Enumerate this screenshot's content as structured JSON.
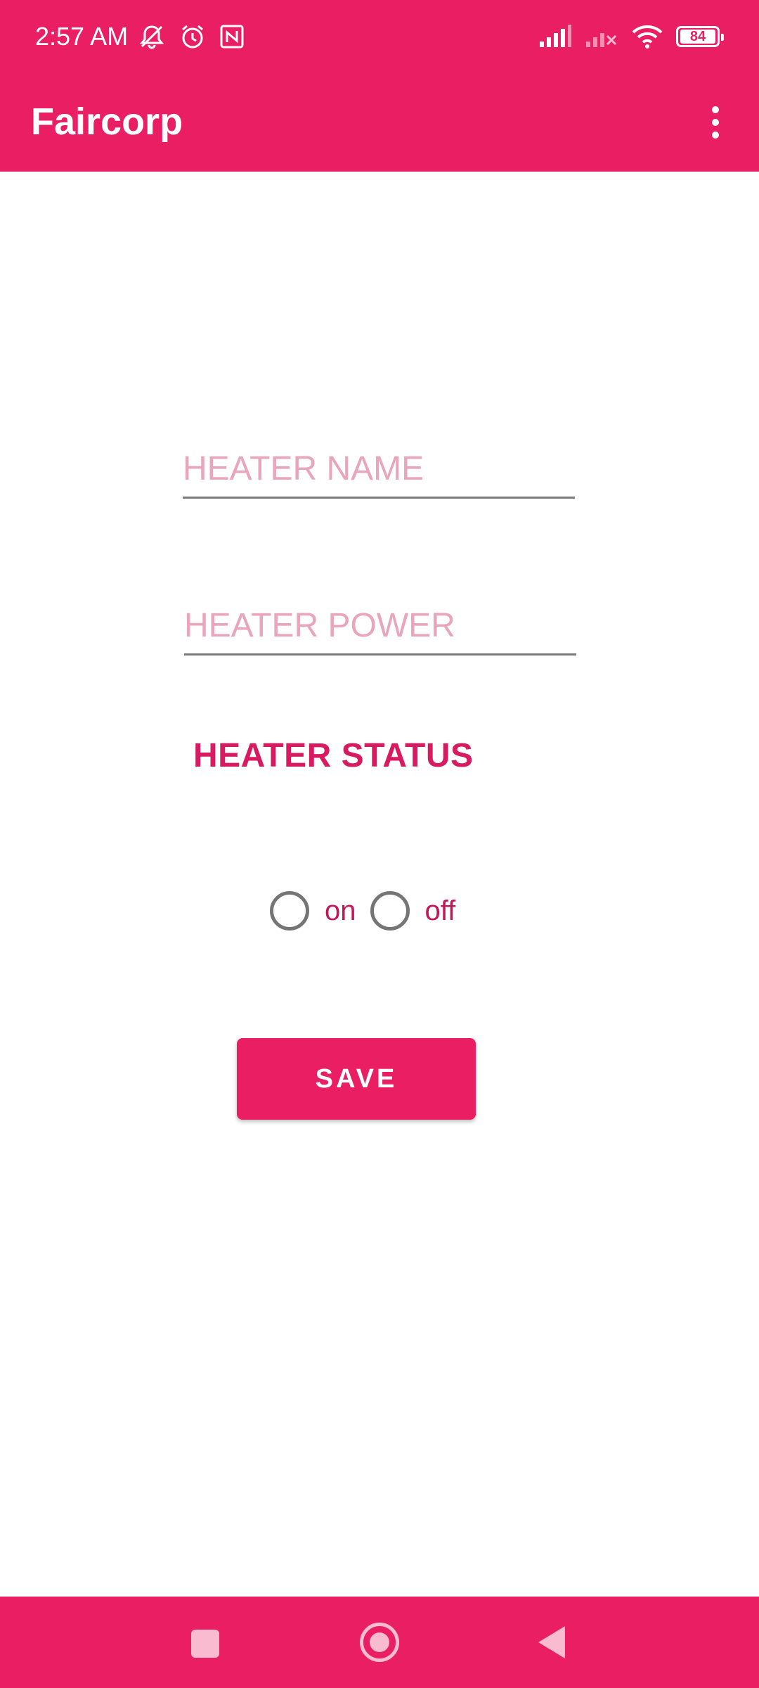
{
  "status_bar": {
    "time": "2:57 AM",
    "battery_level": "84",
    "icons_left": [
      "mute-icon",
      "alarm-icon",
      "nfc-icon"
    ],
    "icons_right": [
      "signal-icon",
      "signal-off-icon",
      "wifi-icon",
      "battery-icon"
    ]
  },
  "app_bar": {
    "title": "Faircorp",
    "menu_icon": "more-vert-icon"
  },
  "form": {
    "heater_name_placeholder": "HEATER NAME",
    "heater_power_placeholder": "HEATER POWER",
    "status_label": "HEATER STATUS",
    "radio_on_label": "on",
    "radio_off_label": "off",
    "save_label": "SAVE"
  },
  "nav_bar": {
    "icons": [
      "recents-icon",
      "home-icon",
      "back-icon"
    ]
  },
  "colors": {
    "primary": "#E91E63",
    "placeholder": "#E8A5BC",
    "accent_text": "#D81B60"
  }
}
